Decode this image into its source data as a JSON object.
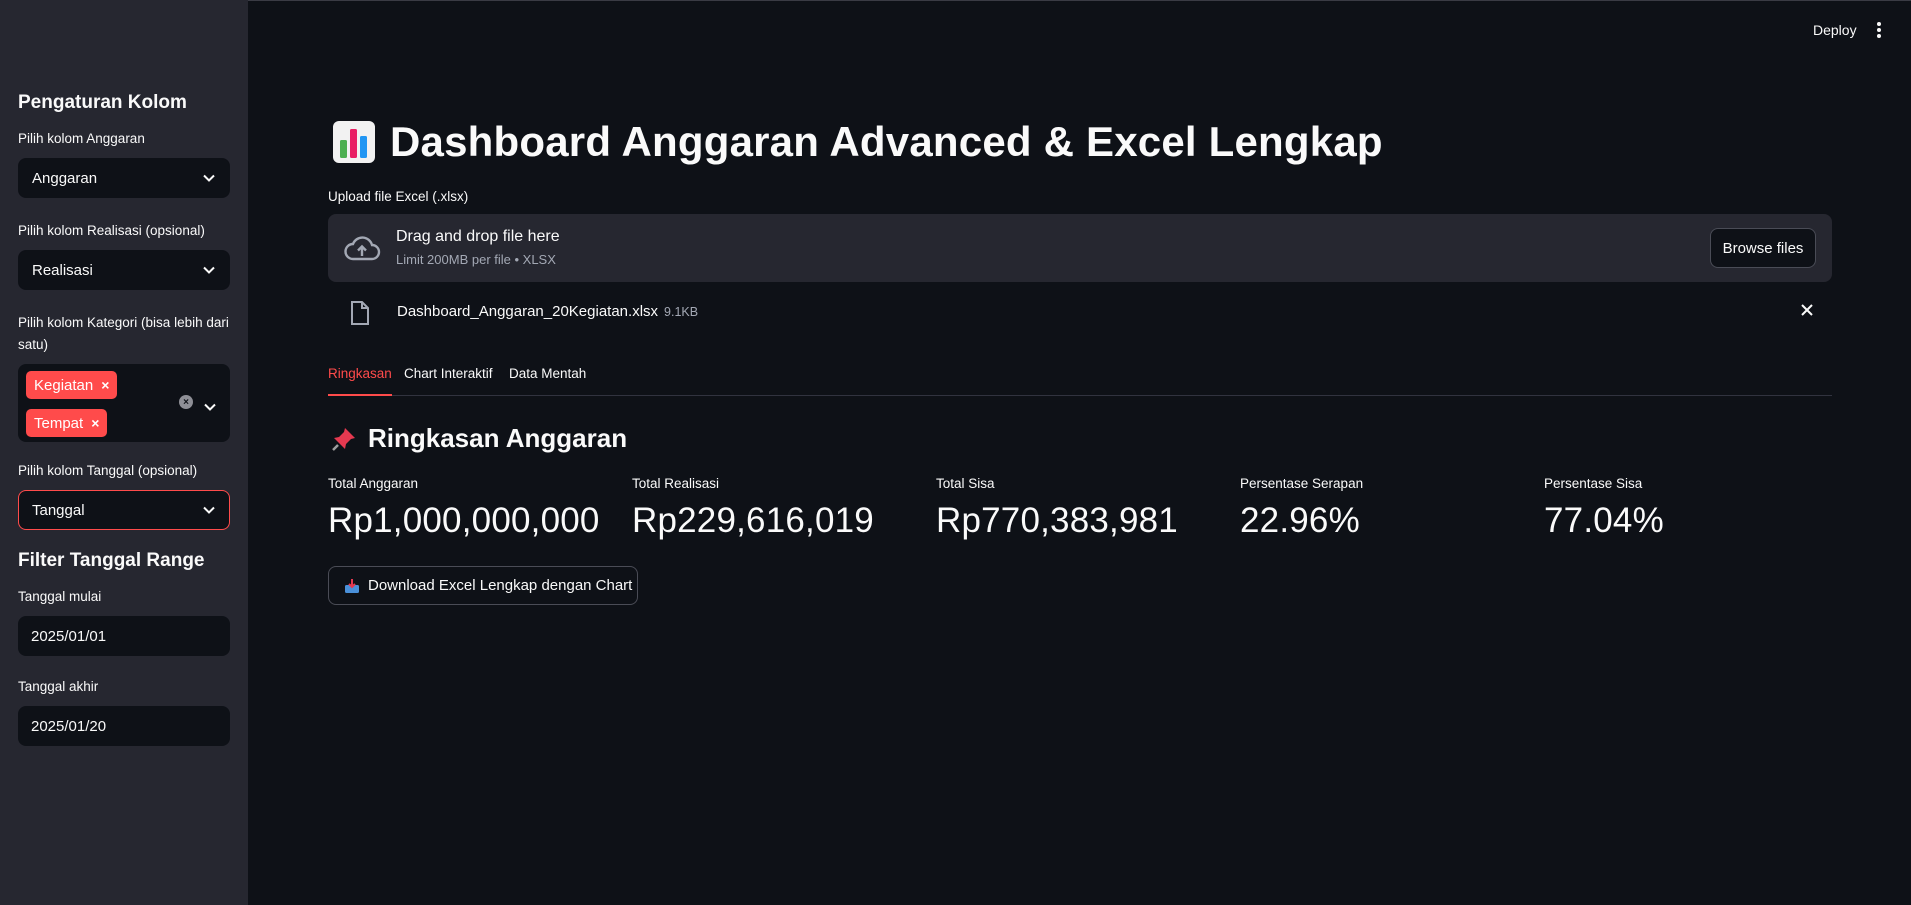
{
  "topbar": {
    "deploy_label": "Deploy",
    "menu_icon": "kebab-menu-icon"
  },
  "sidebar": {
    "section1_title": "Pengaturan Kolom",
    "anggaran": {
      "label": "Pilih kolom Anggaran",
      "value": "Anggaran"
    },
    "realisasi": {
      "label": "Pilih kolom Realisasi (opsional)",
      "value": "Realisasi"
    },
    "kategori": {
      "label": "Pilih kolom Kategori (bisa lebih dari satu)",
      "tags": [
        "Kegiatan",
        "Tempat"
      ]
    },
    "tanggal": {
      "label": "Pilih kolom Tanggal (opsional)",
      "value": "Tanggal"
    },
    "section2_title": "Filter Tanggal Range",
    "start": {
      "label": "Tanggal mulai",
      "value": "2025/01/01"
    },
    "end": {
      "label": "Tanggal akhir",
      "value": "2025/01/20"
    }
  },
  "main": {
    "title": "Dashboard Anggaran Advanced & Excel Lengkap",
    "upload": {
      "label": "Upload file Excel (.xlsx)",
      "drop_text": "Drag and drop file here",
      "limit_text": "Limit 200MB per file • XLSX",
      "browse_label": "Browse files"
    },
    "file": {
      "name": "Dashboard_Anggaran_20Kegiatan.xlsx",
      "size": "9.1KB"
    },
    "tabs": [
      {
        "label": "Ringkasan",
        "active": true
      },
      {
        "label": "Chart Interaktif",
        "active": false
      },
      {
        "label": "Data Mentah",
        "active": false
      }
    ],
    "section_title": "Ringkasan Anggaran",
    "metrics": [
      {
        "label": "Total Anggaran",
        "value": "Rp1,000,000,000"
      },
      {
        "label": "Total Realisasi",
        "value": "Rp229,616,019"
      },
      {
        "label": "Total Sisa",
        "value": "Rp770,383,981"
      },
      {
        "label": "Persentase Serapan",
        "value": "22.96%"
      },
      {
        "label": "Persentase Sisa",
        "value": "77.04%"
      }
    ],
    "download_label": "Download Excel Lengkap dengan Chart"
  },
  "colors": {
    "accent": "#ff4b4b",
    "background": "#0e1117",
    "sidebar": "#262730"
  }
}
